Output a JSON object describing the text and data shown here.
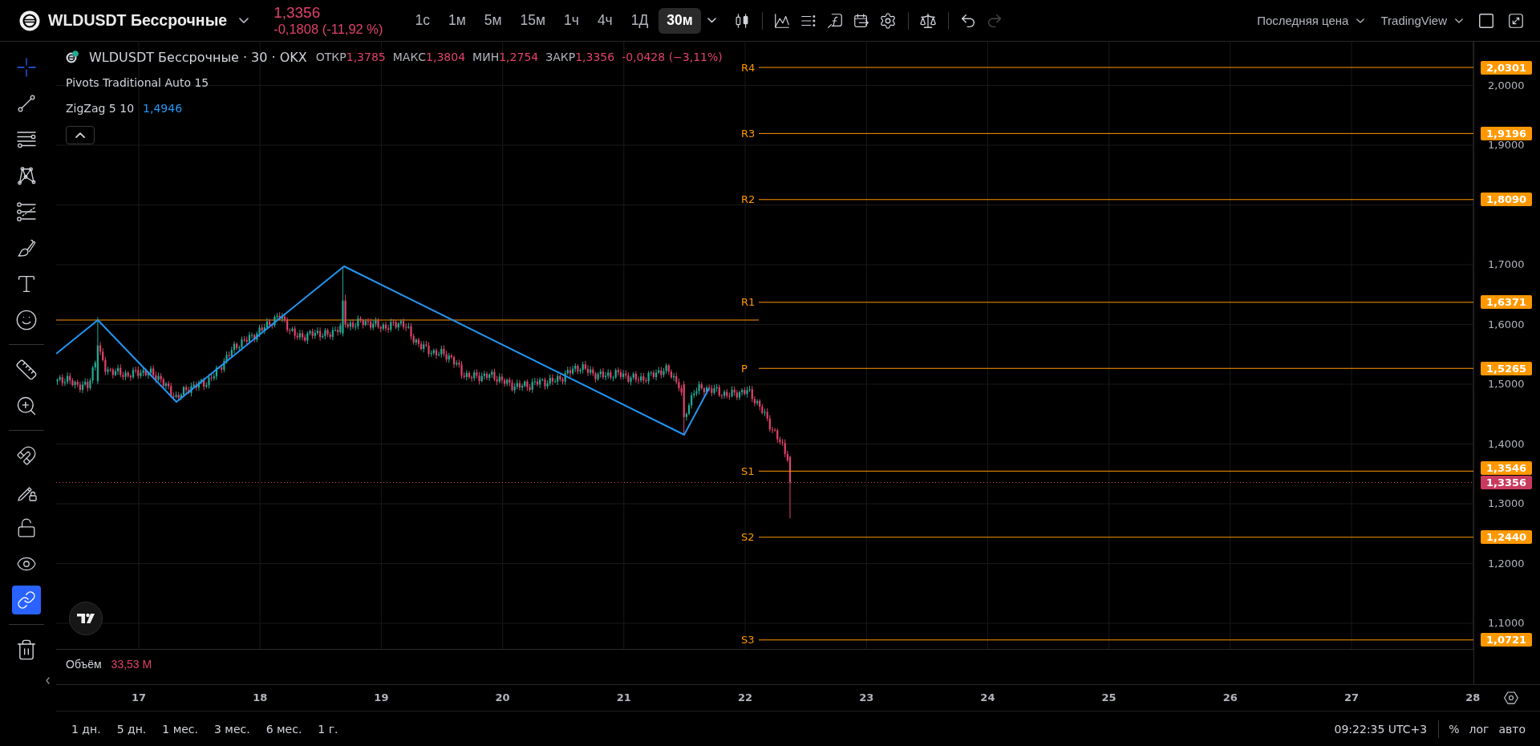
{
  "symbol": {
    "name": "WLDUSDT Бессрочные",
    "price": "1,3356",
    "change": "-0,1808 (-11,92 %)"
  },
  "intervals": [
    {
      "label": "1с",
      "selected": false
    },
    {
      "label": "1м",
      "selected": false
    },
    {
      "label": "5м",
      "selected": false
    },
    {
      "label": "15м",
      "selected": false
    },
    {
      "label": "1ч",
      "selected": false
    },
    {
      "label": "4ч",
      "selected": false
    },
    {
      "label": "1Д",
      "selected": false
    },
    {
      "label": "30м",
      "selected": true
    }
  ],
  "history": [
    {
      "disabled": false
    },
    {
      "disabled": true
    }
  ],
  "price_source": "Последняя цена",
  "layout_name": "TradingView",
  "left_toolbar": {
    "tools": [
      {
        "selected": true
      },
      {
        "selected": false
      },
      {
        "selected": false
      },
      {
        "selected": false
      },
      {
        "selected": false
      },
      {
        "selected": false
      },
      {
        "selected": false
      },
      {
        "selected": false
      }
    ],
    "measure_tools": [
      {
        "selected": false
      },
      {
        "selected": false
      }
    ],
    "toggles": [
      {
        "on": false
      },
      {
        "on": false
      },
      {
        "on": false
      },
      {
        "on": false
      },
      {
        "on": true
      }
    ]
  },
  "legend": {
    "title": "WLDUSDT Бессрочные · 30 · OKX",
    "ohlc": [
      {
        "label": "ОТКР",
        "value": "1,3785"
      },
      {
        "label": "МАКС",
        "value": "1,3804"
      },
      {
        "label": "МИН",
        "value": "1,2754"
      },
      {
        "label": "ЗАКР",
        "value": "1,3356"
      }
    ],
    "change": "-0,0428 (−3,11%)",
    "indicators": [
      {
        "name": "Pivots Traditional Auto 15"
      },
      {
        "name": "ZigZag 5 10",
        "value": "1,4946"
      }
    ]
  },
  "pivots": [
    {
      "label": "R4",
      "value": "2,0301"
    },
    {
      "label": "R3",
      "value": "1,9196"
    },
    {
      "label": "R2",
      "value": "1,8090"
    },
    {
      "label": "R1",
      "value": "1,6371"
    },
    {
      "label": "P",
      "value": "1,5265"
    },
    {
      "label": "S1",
      "value": "1,3546"
    },
    {
      "label": "S2",
      "value": "1,2440"
    },
    {
      "label": "S3",
      "value": "1,0721"
    }
  ],
  "price_axis": {
    "ticks": [
      "2,0000",
      "1,9000",
      "1,7000",
      "1,6000",
      "1,5000",
      "1,4000",
      "1,3000",
      "1,2000",
      "1,1000"
    ],
    "last_price": "1,3356"
  },
  "volume": {
    "label": "Объём",
    "value": "33,53 M"
  },
  "time_axis": [
    "17",
    "18",
    "19",
    "20",
    "21",
    "22",
    "23",
    "24",
    "25",
    "26",
    "27",
    "28"
  ],
  "bottom_bar": {
    "ranges": [
      "1 дн.",
      "5 дн.",
      "1 мес.",
      "3 мес.",
      "6 мес.",
      "1 г."
    ],
    "clock": "09:22:35 UTC+3",
    "scale_options": [
      "%",
      "лог",
      "авто"
    ]
  }
}
